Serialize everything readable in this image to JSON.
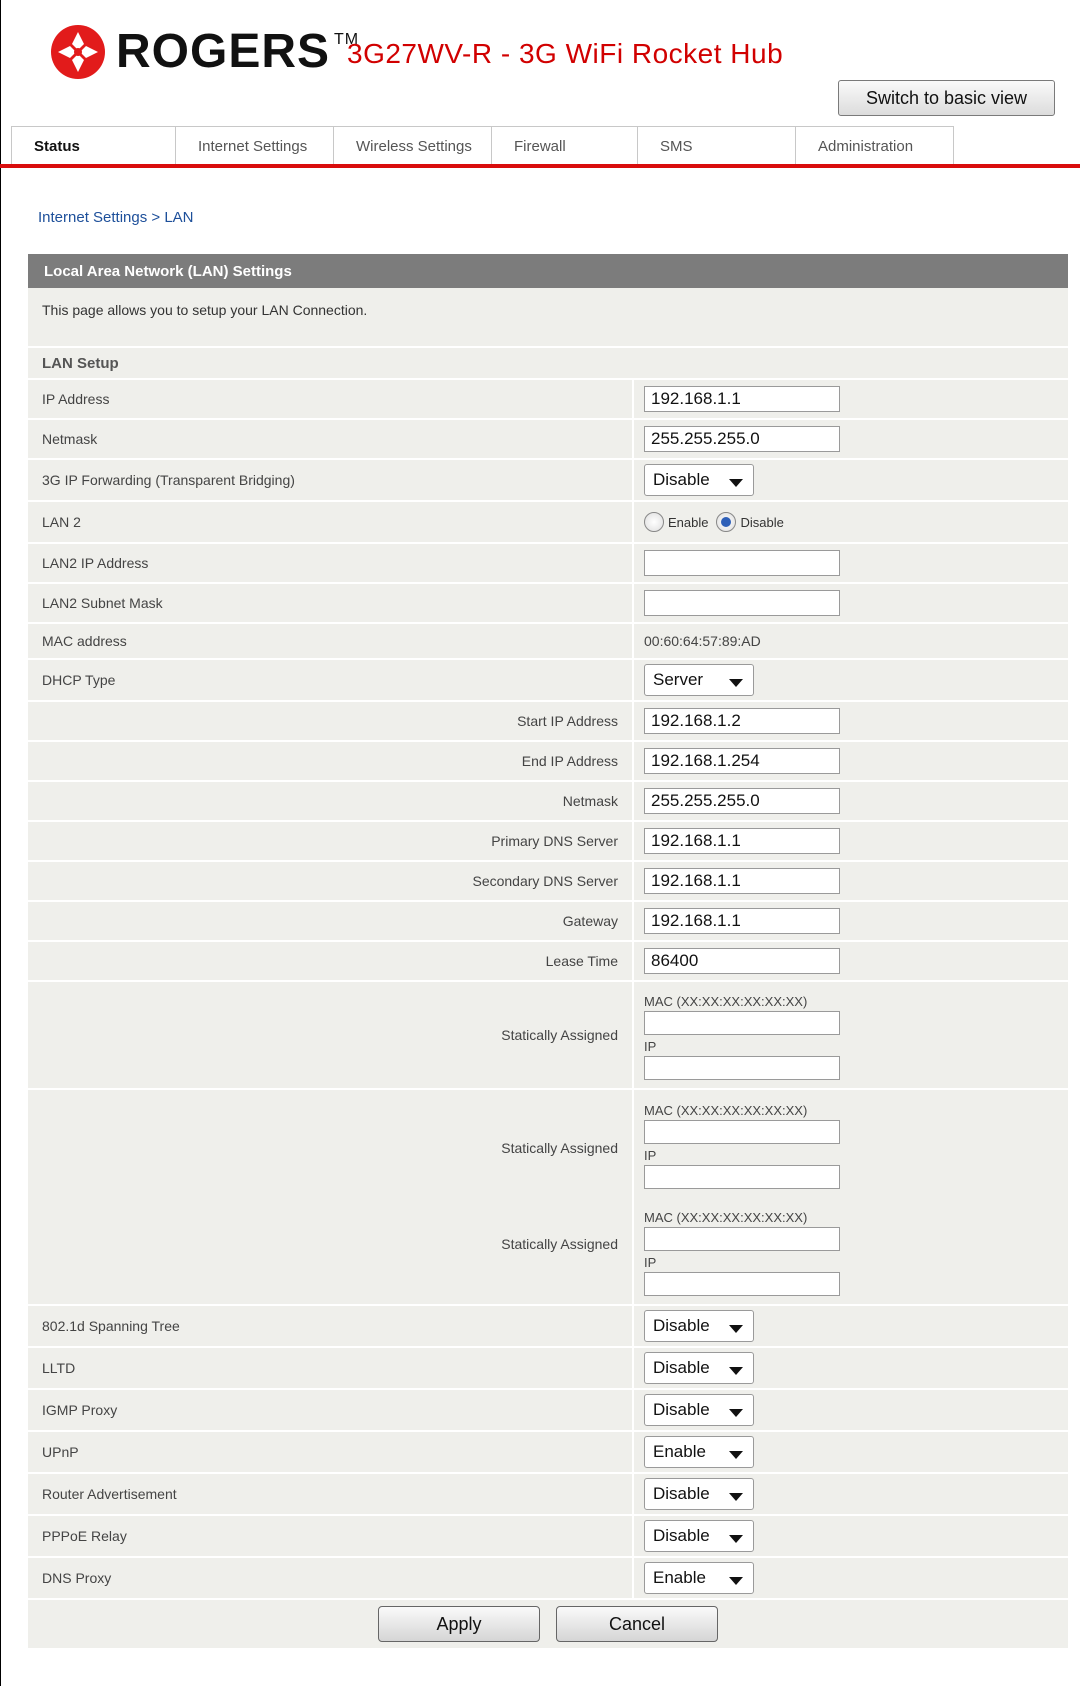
{
  "header": {
    "brand": "ROGERS",
    "trademark": "TM",
    "product": "3G27WV-R - 3G WiFi Rocket Hub",
    "basic_view_button": "Switch to basic view",
    "brand_color": "#d10000"
  },
  "tabs": [
    {
      "label": "Status"
    },
    {
      "label": "Internet Settings"
    },
    {
      "label": "Wireless Settings"
    },
    {
      "label": "Firewall"
    },
    {
      "label": "SMS"
    },
    {
      "label": "Administration"
    }
  ],
  "breadcrumb": "Internet Settings > LAN",
  "panel": {
    "title": "Local Area Network (LAN) Settings",
    "description": "This page allows you to setup your LAN Connection.",
    "section": "LAN Setup"
  },
  "fields": {
    "ip_address": {
      "label": "IP Address",
      "value": "192.168.1.1"
    },
    "netmask": {
      "label": "Netmask",
      "value": "255.255.255.0"
    },
    "ip_forwarding": {
      "label": "3G IP Forwarding (Transparent Bridging)",
      "value": "Disable"
    },
    "lan2": {
      "label": "LAN 2",
      "enable_label": "Enable",
      "disable_label": "Disable",
      "selected": "Disable"
    },
    "lan2_ip": {
      "label": "LAN2 IP Address",
      "value": ""
    },
    "lan2_mask": {
      "label": "LAN2 Subnet Mask",
      "value": ""
    },
    "mac": {
      "label": "MAC address",
      "value": "00:60:64:57:89:AD"
    },
    "dhcp_type": {
      "label": "DHCP Type",
      "value": "Server"
    },
    "start_ip": {
      "label": "Start IP Address",
      "value": "192.168.1.2"
    },
    "end_ip": {
      "label": "End IP Address",
      "value": "192.168.1.254"
    },
    "dhcp_netmask": {
      "label": "Netmask",
      "value": "255.255.255.0"
    },
    "primary_dns": {
      "label": "Primary DNS Server",
      "value": "192.168.1.1"
    },
    "secondary_dns": {
      "label": "Secondary DNS Server",
      "value": "192.168.1.1"
    },
    "gateway": {
      "label": "Gateway",
      "value": "192.168.1.1"
    },
    "lease_time": {
      "label": "Lease Time",
      "value": "86400"
    },
    "static": [
      {
        "label": "Statically Assigned",
        "mac_label": "MAC (XX:XX:XX:XX:XX:XX)",
        "ip_label": "IP",
        "mac_value": "",
        "ip_value": ""
      },
      {
        "label": "Statically Assigned",
        "mac_label": "MAC (XX:XX:XX:XX:XX:XX)",
        "ip_label": "IP",
        "mac_value": "",
        "ip_value": ""
      },
      {
        "label": "Statically Assigned",
        "mac_label": "MAC (XX:XX:XX:XX:XX:XX)",
        "ip_label": "IP",
        "mac_value": "",
        "ip_value": ""
      }
    ],
    "spanning_tree": {
      "label": "802.1d Spanning Tree",
      "value": "Disable"
    },
    "lltd": {
      "label": "LLTD",
      "value": "Disable"
    },
    "igmp": {
      "label": "IGMP Proxy",
      "value": "Disable"
    },
    "upnp": {
      "label": "UPnP",
      "value": "Enable"
    },
    "router_adv": {
      "label": "Router Advertisement",
      "value": "Disable"
    },
    "pppoe": {
      "label": "PPPoE Relay",
      "value": "Disable"
    },
    "dns_proxy": {
      "label": "DNS Proxy",
      "value": "Enable"
    }
  },
  "actions": {
    "apply": "Apply",
    "cancel": "Cancel"
  }
}
